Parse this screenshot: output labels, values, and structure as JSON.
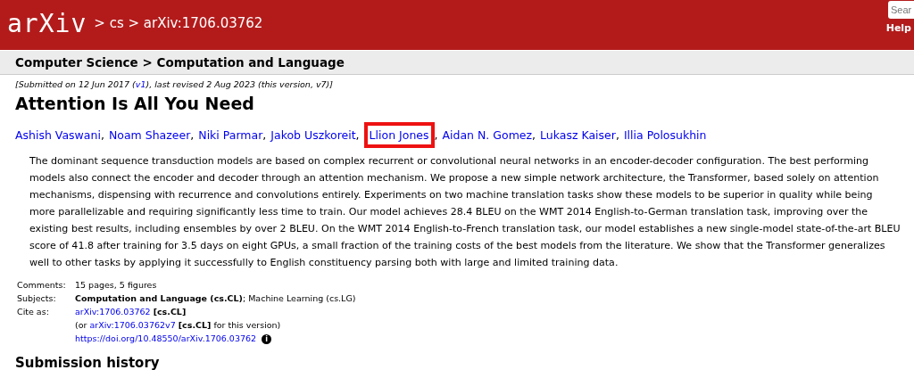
{
  "header": {
    "logo": "arXiv",
    "breadcrumb": "> cs > arXiv:1706.03762",
    "search": {
      "placeholder": "Sear"
    },
    "help": "Help"
  },
  "subheader": "Computer Science > Computation and Language",
  "dateline": {
    "before": "[Submitted on 12 Jun 2017 (",
    "link": "v1",
    "after": "), last revised 2 Aug 2023 (this version, v7)]"
  },
  "title": "Attention Is All You Need",
  "author_separator": ",",
  "authors": [
    {
      "name": "Ashish Vaswani",
      "highlighted": false
    },
    {
      "name": "Noam Shazeer",
      "highlighted": false
    },
    {
      "name": "Niki Parmar",
      "highlighted": false
    },
    {
      "name": "Jakob Uszkoreit",
      "highlighted": false
    },
    {
      "name": "Llion Jones",
      "highlighted": true
    },
    {
      "name": "Aidan N. Gomez",
      "highlighted": false
    },
    {
      "name": "Lukasz Kaiser",
      "highlighted": false
    },
    {
      "name": "Illia Polosukhin",
      "highlighted": false
    }
  ],
  "abstract": "The dominant sequence transduction models are based on complex recurrent or convolutional neural networks in an encoder-decoder configuration. The best performing models also connect the encoder and decoder through an attention mechanism. We propose a new simple network architecture, the Transformer, based solely on attention mechanisms, dispensing with recurrence and convolutions entirely. Experiments on two machine translation tasks show these models to be superior in quality while being more parallelizable and requiring significantly less time to train. Our model achieves 28.4 BLEU on the WMT 2014 English-to-German translation task, improving over the existing best results, including ensembles by over 2 BLEU. On the WMT 2014 English-to-French translation task, our model establishes a new single-model state-of-the-art BLEU score of 41.8 after training for 3.5 days on eight GPUs, a small fraction of the training costs of the best models from the literature. We show that the Transformer generalizes well to other tasks by applying it successfully to English constituency parsing both with large and limited training data.",
  "metadata": {
    "comments": {
      "label": "Comments:",
      "value": "15 pages, 5 figures"
    },
    "subjects": {
      "label": "Subjects:",
      "primary": "Computation and Language (cs.CL)",
      "rest": "; Machine Learning (cs.LG)"
    },
    "cite": {
      "label": "Cite as:",
      "id": "arXiv:1706.03762",
      "id_tag": "[cs.CL]",
      "version_before": "(or ",
      "version_link": "arXiv:1706.03762v7",
      "version_tag": "[cs.CL]",
      "version_after": " for this version)",
      "doi": "https://doi.org/10.48550/arXiv.1706.03762",
      "info_icon": "i"
    }
  },
  "next_heading": "Submission history"
}
